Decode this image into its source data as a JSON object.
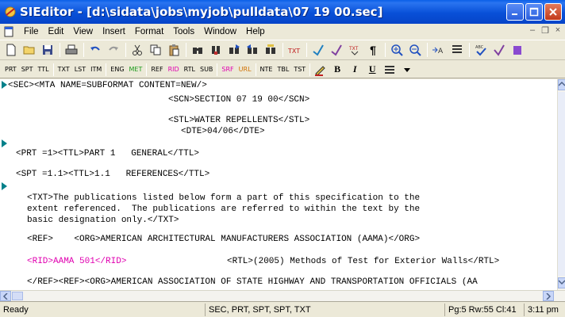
{
  "window": {
    "title": "SIEditor - [d:\\sidata\\jobs\\myjob\\pulldata\\07 19 00.sec]"
  },
  "menu": {
    "items": [
      {
        "label": "File"
      },
      {
        "label": "Edit"
      },
      {
        "label": "View"
      },
      {
        "label": "Insert"
      },
      {
        "label": "Format"
      },
      {
        "label": "Tools"
      },
      {
        "label": "Window"
      },
      {
        "label": "Help"
      }
    ]
  },
  "tag_toolbar": {
    "group1": [
      "PRT",
      "SPT",
      "TTL"
    ],
    "group2": [
      "TXT",
      "LST",
      "ITM"
    ],
    "group3_eng": "ENG",
    "group3_met": "MET",
    "group4_ref": "REF",
    "group4_rid": "RID",
    "group4_rtl": "RTL",
    "group4_sub": "SUB",
    "group5_srf": "SRF",
    "group5_url": "URL",
    "group6": [
      "NTE",
      "TBL",
      "TST"
    ],
    "bold": "B",
    "italic": "I",
    "underline": "U"
  },
  "editor": {
    "lines": [
      "<SEC><MTA NAME=SUBFORMAT CONTENT=NEW/>",
      "<SCN>SECTION 07 19 00</SCN>",
      "<STL>WATER REPELLENTS</STL>",
      "<DTE>04/06</DTE>",
      "<PRT =1><TTL>PART 1   GENERAL</TTL>",
      "<SPT =1.1><TTL>1.1   REFERENCES</TTL>",
      "<TXT>The publications listed below form a part of this specification to the",
      "extent referenced.  The publications are referred to within the text by the",
      "basic designation only.</TXT>",
      "<REF>    <ORG>AMERICAN ARCHITECTURAL MANUFACTURERS ASSOCIATION (AAMA)</ORG>",
      "<RID>AAMA 501</RID>",
      "<RTL>(2005) Methods of Test for Exterior Walls</RTL>",
      "</REF><REF><ORG>AMERICAN ASSOCIATION OF STATE HIGHWAY AND TRANSPORTATION OFFICIALS (AA"
    ]
  },
  "status": {
    "state": "Ready",
    "context": "SEC, PRT, SPT, SPT, TXT",
    "position": "Pg:5 Rw:55 Cl:41",
    "time": "3:11 pm"
  },
  "colors": {
    "titlebar": "#0a54de",
    "rid_tag": "#e000b0",
    "marker": "#00808a",
    "eng_met": "#1a9a1a"
  }
}
